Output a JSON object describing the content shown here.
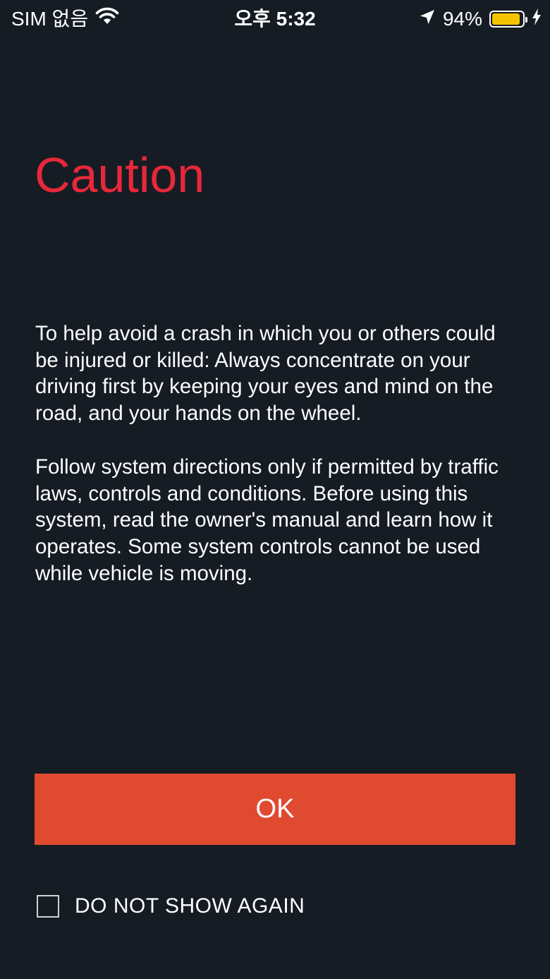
{
  "status_bar": {
    "carrier": "SIM 없음",
    "time": "오후 5:32",
    "battery_percent": "94%",
    "battery_level": 0.94,
    "battery_color": "#f5c400"
  },
  "dialog": {
    "title": "Caution",
    "title_color": "#e8283a",
    "paragraphs": [
      "To help avoid a crash in which you or others could be injured or killed: Always concentrate on your driving first by keeping your eyes and mind on the road, and your hands on the wheel.",
      "Follow system directions only if permitted by traffic laws, controls and conditions. Before using this system, read the owner's manual and learn how it operates. Some system controls cannot be used while vehicle is moving."
    ],
    "ok_label": "OK",
    "ok_color": "#e04a30",
    "do_not_show_label": "DO NOT SHOW AGAIN",
    "do_not_show_checked": false
  }
}
